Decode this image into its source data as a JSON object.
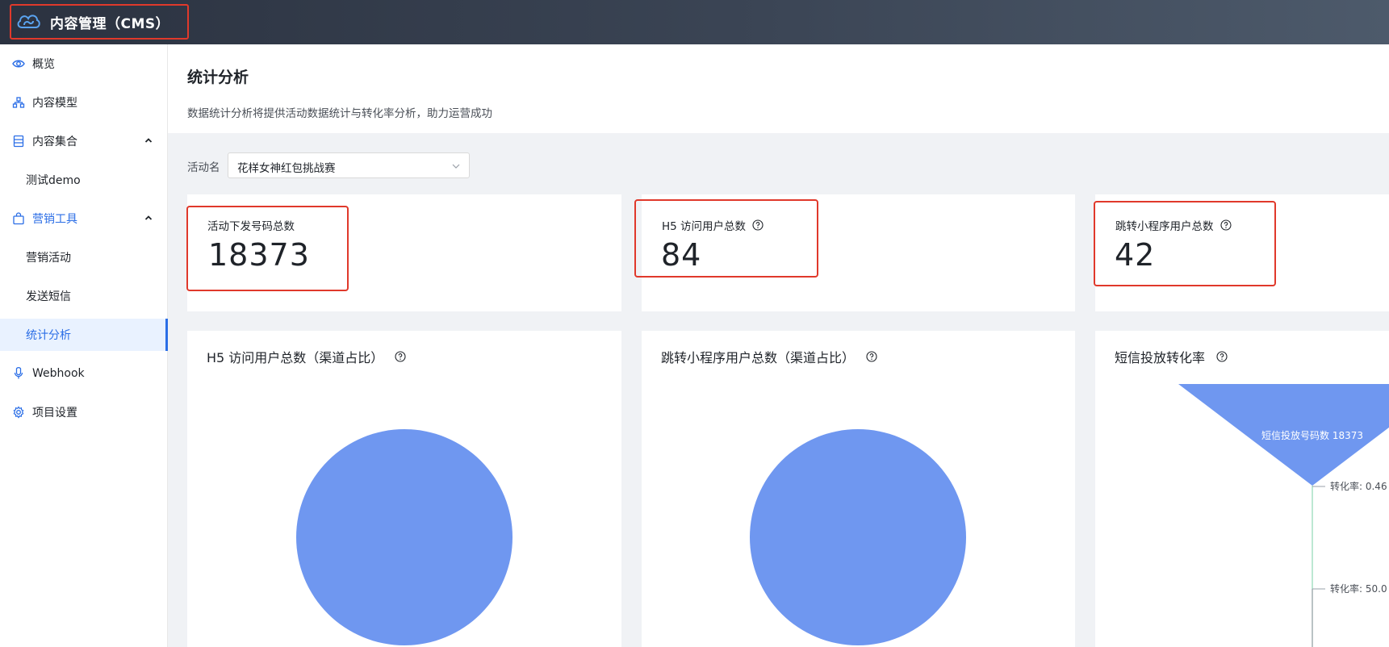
{
  "header": {
    "app_title": "内容管理（CMS）",
    "logo_icon": "cloud-icon",
    "gradient": [
      "#2b3240",
      "#4d5a6b"
    ]
  },
  "sidebar": {
    "items": [
      {
        "label": "概览",
        "icon": "eye-icon"
      },
      {
        "label": "内容模型",
        "icon": "hierarchy-icon"
      },
      {
        "label": "内容集合",
        "icon": "database-icon",
        "expanded": true
      },
      {
        "label": "测试demo"
      },
      {
        "label": "营销工具",
        "icon": "shopping-bag-icon",
        "expanded": true
      },
      {
        "label": "营销活动"
      },
      {
        "label": "发送短信"
      },
      {
        "label": "统计分析",
        "active": true
      },
      {
        "label": "Webhook",
        "icon": "webhook-icon"
      },
      {
        "label": "项目设置",
        "icon": "gear-icon"
      }
    ]
  },
  "page": {
    "title": "统计分析",
    "description": "数据统计分析将提供活动数据统计与转化率分析，助力运营成功"
  },
  "filter": {
    "label": "活动名",
    "selected": "花样女神红包挑战赛"
  },
  "stats": [
    {
      "label": "活动下发号码总数",
      "value": "18373",
      "has_help": false
    },
    {
      "label": "H5 访问用户总数",
      "value": "84",
      "has_help": true
    },
    {
      "label": "跳转小程序用户总数",
      "value": "42",
      "has_help": true
    }
  ],
  "charts": [
    {
      "title": "H5 访问用户总数（渠道占比）"
    },
    {
      "title": "跳转小程序用户总数（渠道占比）"
    },
    {
      "title": "短信投放转化率"
    }
  ],
  "chart_data": [
    {
      "type": "pie",
      "title": "H5 访问用户总数（渠道占比）",
      "slices": [
        {
          "value": 1
        }
      ],
      "color": "#6f97f0"
    },
    {
      "type": "pie",
      "title": "跳转小程序用户总数（渠道占比）",
      "slices": [
        {
          "value": 1
        }
      ],
      "color": "#6f97f0"
    },
    {
      "type": "funnel",
      "title": "短信投放转化率",
      "stages": [
        {
          "label": "短信投放号码数 18373",
          "value": 18373
        }
      ],
      "conversion_labels": [
        "转化率: 0.46",
        "转化率: 50.0"
      ],
      "color": "#6f97f0"
    }
  ],
  "colors": {
    "accent": "#2b6ee6",
    "highlight_border": "#e0392b",
    "chart_fill": "#6f97f0"
  }
}
